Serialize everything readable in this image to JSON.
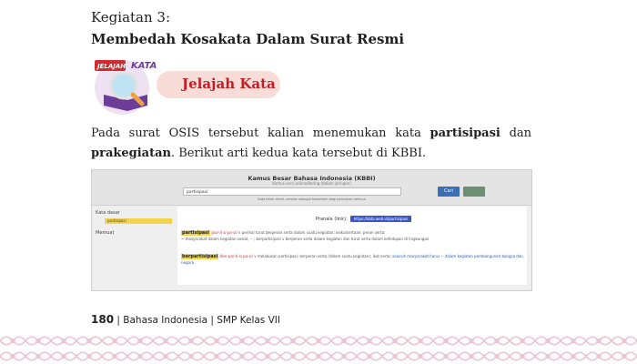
{
  "activity": {
    "label": "Kegiatan 3:",
    "title": "Membedah Kosakata Dalam Surat Resmi"
  },
  "badge": {
    "logo_text_left": "JELAJAH",
    "logo_text_right": "KATA",
    "label": "Jelajah Kata",
    "logo_icon": "magnifier-book-icon"
  },
  "paragraph": {
    "line1_a": "Pada surat OSIS tersebut kalian menemukan kata ",
    "line1_bold": "partisipasi",
    "line1_b": " dan",
    "line2_bold": "prakegiatan",
    "line2_a": ". Berikut arti kedua kata tersebut di KBBI."
  },
  "kbbi": {
    "title": "Kamus Besar Bahasa Indonesia (KBBI)",
    "subtitle": "Kamus versi online/daring (dalam jaringan)",
    "search_value": "partisipasi",
    "cari_label": "Cari",
    "hint": "Kata telah dicari, simpan sebagai bookmark bagi pencarian lainnya",
    "sidebar_label1": "Kata dasar",
    "sidebar_selected": "partisipasi",
    "sidebar_label2": "Memuat",
    "pranala_label": "Pranala (link):",
    "pranala_url": "https://kbbi.web.id/partisipasi",
    "entry1_word": "partisipasi",
    "entry1_pron": "/par·ti·si·pa·si/",
    "entry1_def": "n perihal turut berperan serta dalam suatu kegiatan; keikutsertaan; peran serta:",
    "entry1_example": "~ masyarakat dalam kegiatan sosial; -- ; berpartisipasi v berperan serta dalam kegiatan dan turut serta dalam kehidupan di lingkungan",
    "entry2_word": "berpartisipasi",
    "entry2_pron": "/ber·par·ti·si·pa·si/",
    "entry2_def": "v melakukan partisipasi; berperan serta (dalam suatu kegiatan); ikut serta:",
    "entry2_example": "seluruh masyarakat harus -- dalam kegiatan pembangunan bangsa dan negara"
  },
  "footer": {
    "page_number": "180",
    "book": "| Bahasa Indonesia | SMP Kelas VII"
  },
  "colors": {
    "accent_red": "#c21f25",
    "pill_bg": "#f7dcd8",
    "ornament": "#e9c3d6",
    "highlight": "#f2d34a"
  }
}
